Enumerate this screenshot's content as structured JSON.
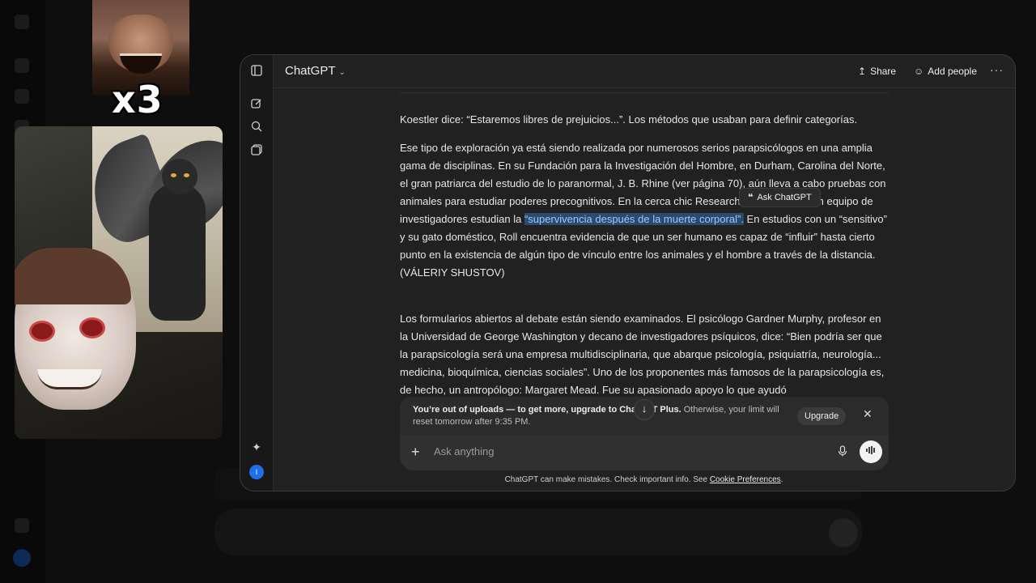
{
  "app": {
    "title": "ChatGPT",
    "header_actions": {
      "share": "Share",
      "add_people": "Add people",
      "more": "···"
    }
  },
  "sidebar": {
    "icons": [
      "sidebar-toggle-icon",
      "new-chat-icon",
      "search-icon",
      "library-icon",
      "sparkle-icon"
    ],
    "avatar_initial": "I"
  },
  "overlay": {
    "meme_caption": "x3"
  },
  "message": {
    "p1": "Koestler dice: “Estaremos libres de prejuicios...”. Los métodos que usaban para definir categorías.",
    "p2_a": "Ese tipo de exploración ya está siendo realizada por numerosos serios parapsicólogos en una amplia gama de disciplinas. En su Fundación para la Investigación del Hombre, en Durham, Carolina del Norte, el gran patriarca del estudio de lo paranormal, J. B. Rhine (ver página 70), aún lleva a cabo pruebas con animales para estudiar poderes precognitivos. En la cerca",
    "p2_a2": " chic Research, William Roll y un equipo de investigadores estudian la ",
    "p2_highlight": "“supervivencia después de la muerte corporal”.",
    "p2_b": " En estudios con un “sensitivo” y su gato doméstico, Roll encuentra evidencia de que un ser humano es capaz de “influir” hasta cierto punto en la existencia de algún tipo de vínculo entre los animales y el hombre a través de la distancia.",
    "p2_author": "(VÁLERIY SHUSTOV)",
    "p3": "Los formularios abiertos al debate están siendo examinados. El psicólogo Gardner Murphy, profesor en la Universidad de George Washington y decano de investigadores psíquicos, dice: “Bien podría ser que la parapsicología será una empresa multidisciplinaria, que abarque psicología, psiquiatría, neurología... medicina, bioquímica, ciencias sociales”. Uno de los proponentes más famosos de la parapsicología es, de hecho, un antropólogo: Margaret Mead. Fue su apasionado apoyo lo que ayudó"
  },
  "selection_popup": {
    "label": "Ask ChatGPT"
  },
  "upsell": {
    "bold": "You’re out of uploads — to get more, upgrade to ChatGPT Plus.",
    "rest": " Otherwise, your limit will reset tomorrow after 9:35 PM.",
    "button": "Upgrade"
  },
  "composer": {
    "placeholder": "Ask anything"
  },
  "footer": {
    "text": "ChatGPT can make mistakes. Check important info. See ",
    "link": "Cookie Preferences",
    "end": "."
  }
}
